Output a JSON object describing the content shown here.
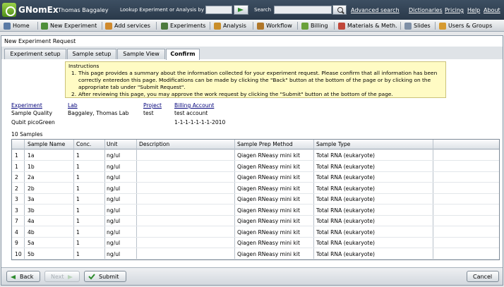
{
  "header": {
    "brand": "GNomEx",
    "user": "Thomas Baggaley",
    "lookup_label": "Lookup Experiment or Analysis by #",
    "search_label": "Search",
    "links": [
      "Advanced search",
      "Dictionaries",
      "Pricing",
      "Help",
      "About"
    ]
  },
  "menu": [
    {
      "label": "Home",
      "icon": "home-icon",
      "color": "#5a7aa5"
    },
    {
      "label": "New Experiment",
      "icon": "new-experiment-icon",
      "color": "#4f8f3a"
    },
    {
      "label": "Add services",
      "icon": "add-services-icon",
      "color": "#d08a2d"
    },
    {
      "label": "Experiments",
      "icon": "flask-icon",
      "color": "#4d7a3e"
    },
    {
      "label": "Analysis",
      "icon": "analysis-icon",
      "color": "#c98e2a"
    },
    {
      "label": "Workflow",
      "icon": "workflow-icon",
      "color": "#b0772a"
    },
    {
      "label": "Billing",
      "icon": "billing-icon",
      "color": "#6aa13a"
    },
    {
      "label": "Materials & Meth.",
      "icon": "materials-icon",
      "color": "#c0473a"
    },
    {
      "label": "Slides",
      "icon": "slides-icon",
      "color": "#7e8fa6"
    },
    {
      "label": "Users & Groups",
      "icon": "users-icon",
      "color": "#d69a30"
    }
  ],
  "window": {
    "title": "New Experiment Request",
    "tabs": [
      "Experiment setup",
      "Sample setup",
      "Sample View",
      "Confirm"
    ]
  },
  "instructions": {
    "title": "Instructions",
    "items": [
      "This page provides a summary about the information collected for your experiment request.  Please confirm that all information has been correctly enteredon this page. Modifications can be made by clicking the \"Back\" button at the bottom of the page or by clicking on the appropriate tab under \"Submit Request\".",
      "After reviewing this page, you may approve the work request by clicking the \"Submit\" button at the bottom of the page."
    ]
  },
  "summary": {
    "headers": {
      "experiment": "Experiment",
      "lab": "Lab",
      "project": "Project",
      "billing": "Billing Account"
    },
    "experiment": [
      "Sample Quality",
      "Qubit picoGreen"
    ],
    "lab": "Baggaley, Thomas Lab",
    "project": "test",
    "billing": [
      "test account",
      "1-1-1-1-1-1-1-2010"
    ]
  },
  "samples": {
    "count_label": "10 Samples",
    "columns": [
      "",
      "Sample Name",
      "Conc.",
      "Unit",
      "Description",
      "Sample Prep Method",
      "Sample Type"
    ],
    "rows": [
      [
        "1",
        "1a",
        "1",
        "ng/ul",
        "",
        "Qiagen RNeasy mini kit",
        "Total RNA (eukaryote)"
      ],
      [
        "1",
        "1b",
        "1",
        "ng/ul",
        "",
        "Qiagen RNeasy mini kit",
        "Total RNA (eukaryote)"
      ],
      [
        "2",
        "2a",
        "1",
        "ng/ul",
        "",
        "Qiagen RNeasy mini kit",
        "Total RNA (eukaryote)"
      ],
      [
        "2",
        "2b",
        "1",
        "ng/ul",
        "",
        "Qiagen RNeasy mini kit",
        "Total RNA (eukaryote)"
      ],
      [
        "3",
        "3a",
        "1",
        "ng/ul",
        "",
        "Qiagen RNeasy mini kit",
        "Total RNA (eukaryote)"
      ],
      [
        "3",
        "3b",
        "1",
        "ng/ul",
        "",
        "Qiagen RNeasy mini kit",
        "Total RNA (eukaryote)"
      ],
      [
        "7",
        "4a",
        "1",
        "ng/ul",
        "",
        "Qiagen RNeasy mini kit",
        "Total RNA (eukaryote)"
      ],
      [
        "4",
        "4b",
        "1",
        "ng/ul",
        "",
        "Qiagen RNeasy mini kit",
        "Total RNA (eukaryote)"
      ],
      [
        "9",
        "5a",
        "1",
        "ng/ul",
        "",
        "Qiagen RNeasy mini kit",
        "Total RNA (eukaryote)"
      ],
      [
        "10",
        "5b",
        "1",
        "ng/ul",
        "",
        "Qiagen RNeasy mini kit",
        "Total RNA (eukaryote)"
      ]
    ]
  },
  "buttons": {
    "back": "Back",
    "next": "Next",
    "submit": "Submit",
    "cancel": "Cancel"
  }
}
